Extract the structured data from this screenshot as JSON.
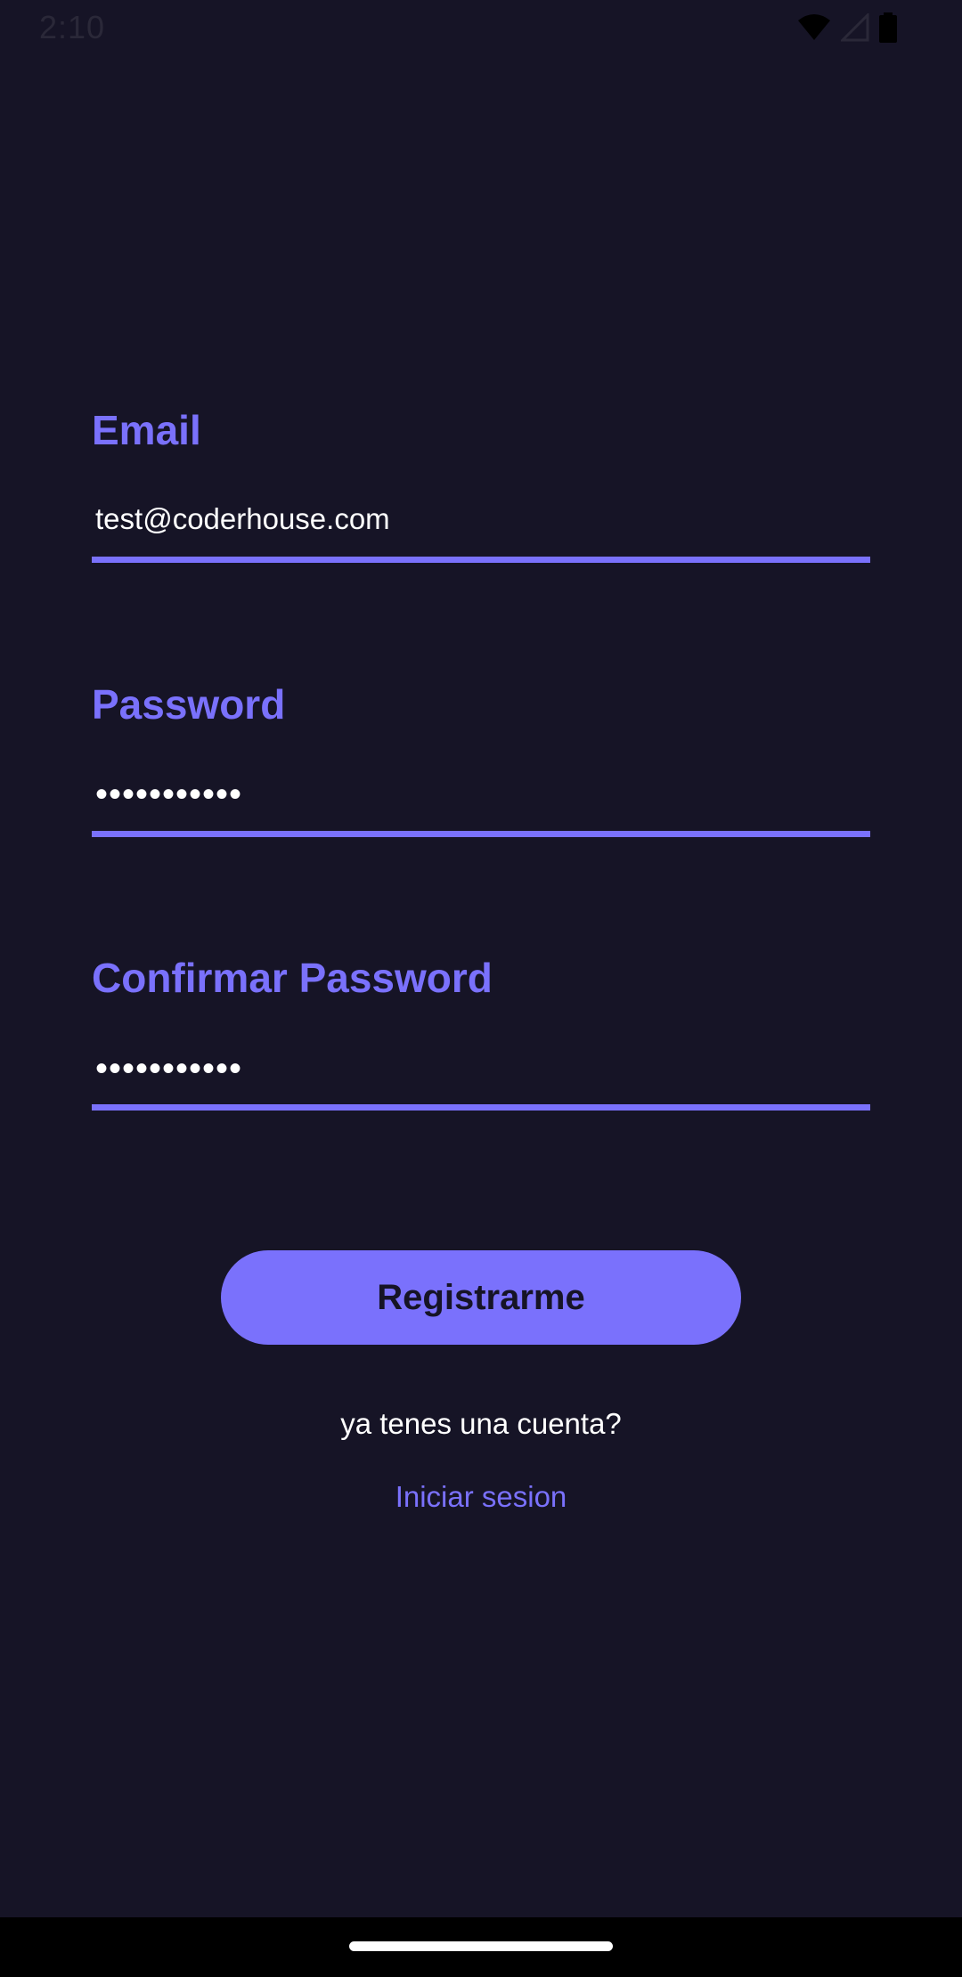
{
  "status_bar": {
    "time": "2:10",
    "icons": [
      "wifi-icon",
      "signal-icon",
      "battery-icon"
    ]
  },
  "form": {
    "email": {
      "label": "Email",
      "value": "test@coderhouse.com"
    },
    "password": {
      "label": "Password",
      "value": "•••••••••••"
    },
    "confirm_password": {
      "label": "Confirmar Password",
      "value": "•••••••••••"
    },
    "submit_label": "Registrarme"
  },
  "footer": {
    "question": "ya tenes una cuenta?",
    "login_link": "Iniciar sesion"
  },
  "colors": {
    "background": "#161426",
    "accent": "#7a71fc",
    "text": "#ffffff"
  }
}
